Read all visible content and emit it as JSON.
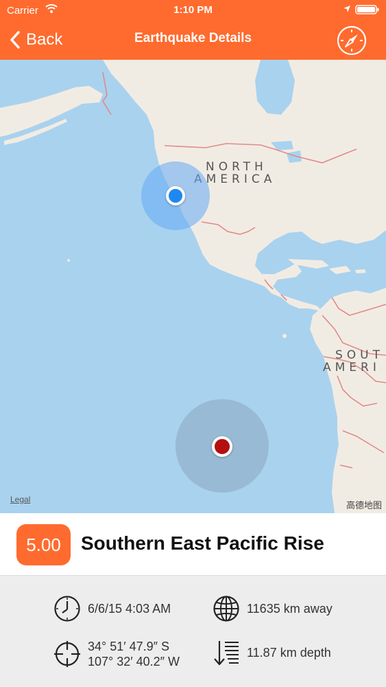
{
  "status_bar": {
    "carrier": "Carrier",
    "time": "1:10 PM"
  },
  "nav": {
    "back_label": "Back",
    "title": "Earthquake Details"
  },
  "map": {
    "labels": {
      "north_1": "NORTH",
      "north_2": "AMERICA",
      "south_1": "SOUT",
      "south_2": "AMERI"
    },
    "legal": "Legal",
    "attribution": "高德地图"
  },
  "quake": {
    "magnitude": "5.00",
    "location": "Southern East Pacific Rise",
    "date": "6/6/15 4:03 AM",
    "distance": "11635 km away",
    "latitude": "34° 51′ 47.9″ S",
    "longitude": "107° 32′ 40.2″ W",
    "depth": "11.87 km depth"
  },
  "colors": {
    "accent": "#FF6B2E",
    "water": "#A9D2EF",
    "land": "#F1ECE3",
    "border": "#E08A8A",
    "user_dot": "#1E88F0",
    "quake_pin": "#B50F0F"
  },
  "icons": {
    "back": "chevron-left-icon",
    "compass": "compass-icon",
    "date": "clock-icon",
    "distance": "globe-icon",
    "coords": "crosshair-icon",
    "depth": "depth-icon"
  }
}
